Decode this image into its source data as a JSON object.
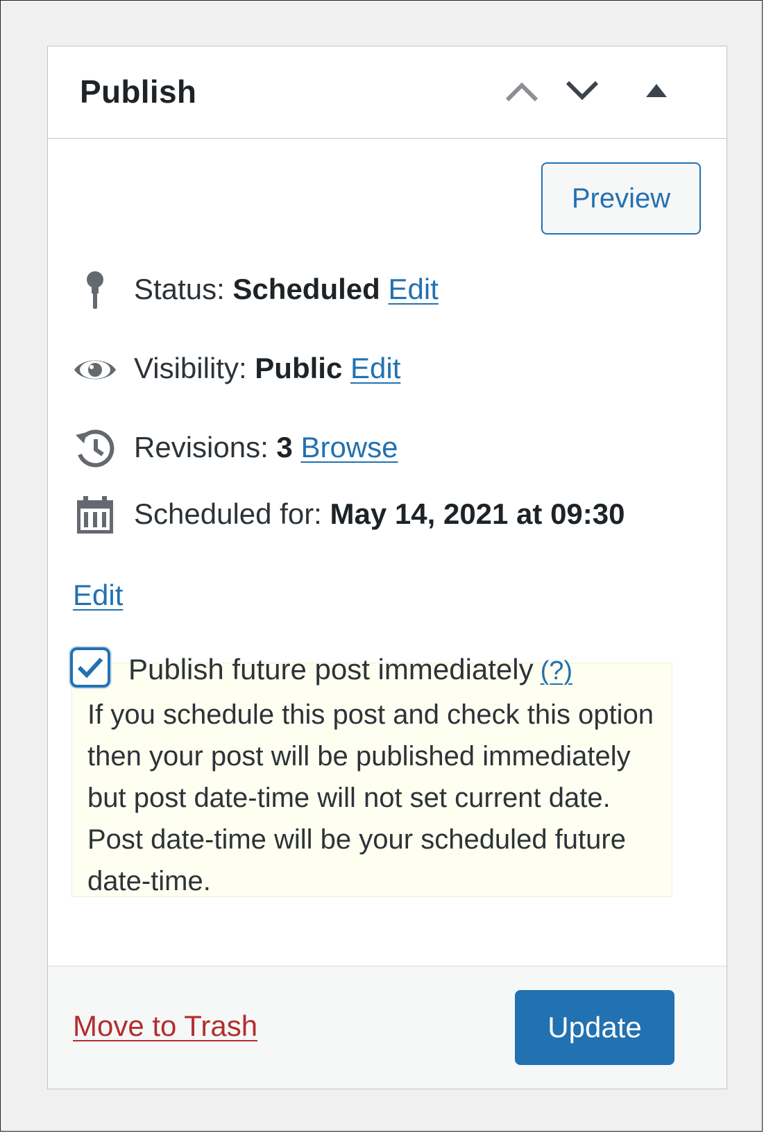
{
  "panel": {
    "title": "Publish",
    "header_controls": [
      "move-up-icon",
      "move-down-icon",
      "toggle-panel-icon"
    ]
  },
  "preview_label": "Preview",
  "status": {
    "label": "Status:",
    "value": "Scheduled",
    "edit_label": "Edit",
    "icon": "pin-icon"
  },
  "visibility": {
    "label": "Visibility:",
    "value": "Public",
    "edit_label": "Edit",
    "icon": "eye-icon"
  },
  "revisions": {
    "label": "Revisions:",
    "value": "3",
    "browse_label": "Browse",
    "icon": "history-icon"
  },
  "schedule": {
    "label": "Scheduled for:",
    "value": "May 14, 2021 at 09:30",
    "edit_label": "Edit",
    "icon": "calendar-icon"
  },
  "publish_future": {
    "checked": true,
    "label": "Publish future post immediately",
    "help_label": "(?)",
    "notice": "If you schedule this post and check this option then your post will be published immediately but post date-time will not set current date. Post date-time will be your scheduled future date-time."
  },
  "footer": {
    "trash_label": "Move to Trash",
    "update_label": "Update"
  },
  "colors": {
    "accent": "#2271b1",
    "trash": "#b32d2e",
    "notice_bg": "#fefef1"
  }
}
